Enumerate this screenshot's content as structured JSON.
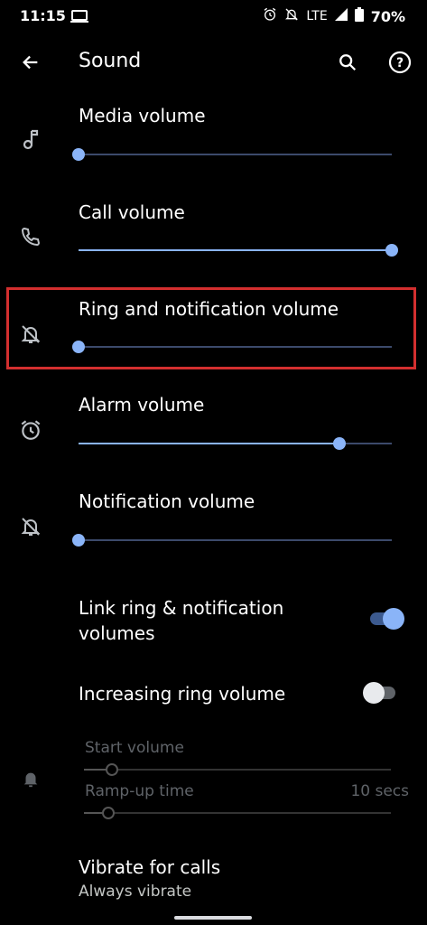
{
  "status": {
    "time": "11:15",
    "network": "LTE",
    "battery": "70%"
  },
  "appbar": {
    "title": "Sound"
  },
  "sliders": [
    {
      "label": "Media volume",
      "value": 0,
      "icon": "music-note-icon"
    },
    {
      "label": "Call volume",
      "value": 1.0,
      "icon": "phone-icon"
    },
    {
      "label": "Ring and notification volume",
      "value": 0,
      "icon": "bell-off-icon"
    },
    {
      "label": "Alarm volume",
      "value": 0.833,
      "icon": "alarm-clock-icon"
    },
    {
      "label": "Notification volume",
      "value": 0,
      "icon": "bell-off-icon"
    }
  ],
  "link_ring": {
    "label_line1": "Link ring & notification",
    "label_line2": "volumes",
    "on": true
  },
  "increasing_ring": {
    "label": "Increasing ring volume",
    "on": false
  },
  "start_volume": {
    "label": "Start volume",
    "value": 0.09
  },
  "ramp_up": {
    "label": "Ramp-up time",
    "value_text": "10 secs",
    "value": 0.08
  },
  "vibrate": {
    "label": "Vibrate for calls",
    "sub": "Always vibrate"
  },
  "colors": {
    "accent": "#8ab4f8",
    "highlight": "#d32f2f",
    "background": "#000000"
  }
}
